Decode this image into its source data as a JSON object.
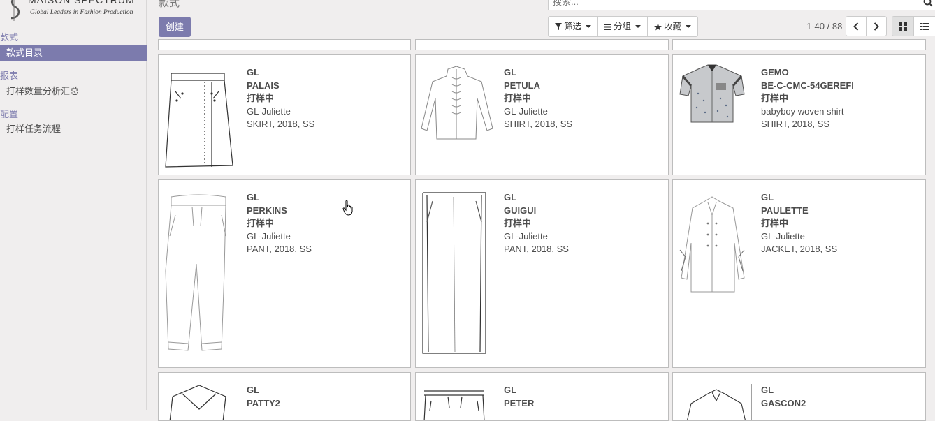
{
  "brand": {
    "name": "MAISON SPECTRUM",
    "tagline": "Global Leaders in Fashion Production"
  },
  "menu": {
    "sections": [
      {
        "title": "款式",
        "items": [
          "款式目录"
        ]
      },
      {
        "title": "报表",
        "items": [
          "打样数量分析汇总"
        ]
      },
      {
        "title": "配置",
        "items": [
          "打样任务流程"
        ]
      }
    ]
  },
  "breadcrumb": "款式",
  "search": {
    "placeholder": "搜索..."
  },
  "buttons": {
    "create": "创建",
    "filter": "筛选",
    "group": "分组",
    "favorites": "收藏"
  },
  "pager": {
    "text": "1-40 / 88"
  },
  "cards": [
    {
      "brand": "GL",
      "name": "PALAIS",
      "state": "打样中",
      "collection": "GL-Juliette",
      "meta": "SKIRT, 2018, SS",
      "sketch": "skirt-sketch"
    },
    {
      "brand": "GL",
      "name": "PETULA",
      "state": "打样中",
      "collection": "GL-Juliette",
      "meta": "SHIRT, 2018, SS",
      "sketch": "shirt-sketch"
    },
    {
      "brand": "GEMO",
      "name": "BE-C-CMC-54GEREFI",
      "state": "打样中",
      "collection": "babyboy woven shirt",
      "meta": "SHIRT, 2018, SS",
      "sketch": "baby-shirt-photo"
    },
    {
      "brand": "GL",
      "name": "PERKINS",
      "state": "打样中",
      "collection": "GL-Juliette",
      "meta": "PANT, 2018, SS",
      "sketch": "pant-sketch"
    },
    {
      "brand": "GL",
      "name": "GUIGUI",
      "state": "打样中",
      "collection": "GL-Juliette",
      "meta": "PANT, 2018, SS",
      "sketch": "pant-sketch-2"
    },
    {
      "brand": "GL",
      "name": "PAULETTE",
      "state": "打样中",
      "collection": "GL-Juliette",
      "meta": "JACKET, 2018, SS",
      "sketch": "coat-sketch"
    },
    {
      "brand": "GL",
      "name": "PATTY2",
      "state": "",
      "collection": "",
      "meta": "",
      "sketch": "top-sketch"
    },
    {
      "brand": "GL",
      "name": "PETER",
      "state": "",
      "collection": "",
      "meta": "",
      "sketch": "pant-sketch-3"
    },
    {
      "brand": "GL",
      "name": "GASCON2",
      "state": "",
      "collection": "",
      "meta": "",
      "sketch": "jacket-sketch"
    }
  ]
}
